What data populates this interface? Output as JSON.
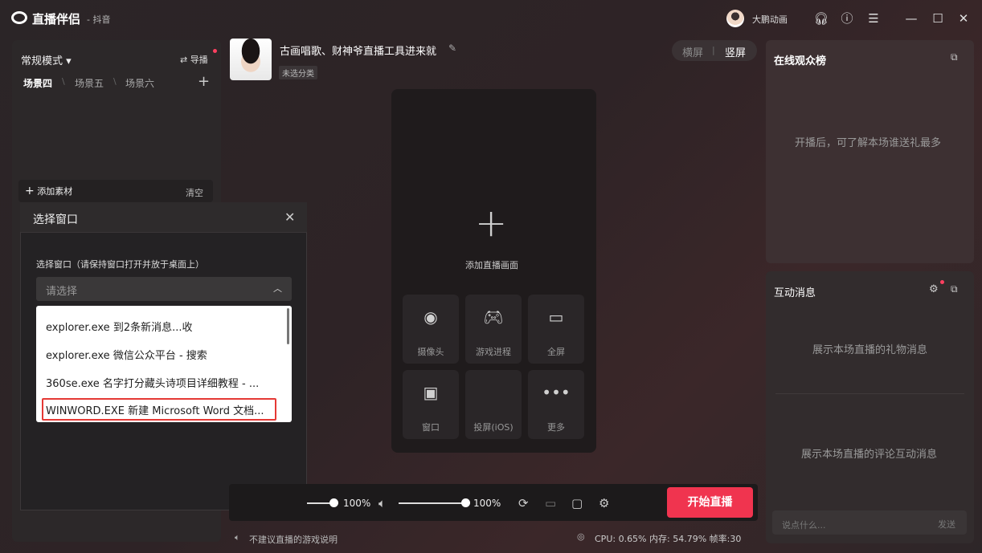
{
  "app": {
    "name": "直播伴侣",
    "sub": "- 抖音"
  },
  "user": {
    "name": "大鹏动画"
  },
  "titlebar_icons": [
    "headset-icon",
    "help-icon",
    "menu-icon",
    "minimize-icon",
    "maximize-icon",
    "close-icon"
  ],
  "left": {
    "mode": "常规模式 ▾",
    "import_label": "⇄ 导播",
    "scenes": [
      "场景四",
      "场景五",
      "场景六"
    ],
    "add_material": "添加素材",
    "clear": "清空"
  },
  "dialog": {
    "title": "选择窗口",
    "field_label": "选择窗口（请保持窗口打开并放于桌面上）",
    "placeholder": "请选择",
    "options": [
      "explorer.exe 到2条新消息...收",
      "explorer.exe 微信公众平台 - 搜索",
      "360se.exe 名字打分藏头诗项目详细教程 - ...",
      "WINWORD.EXE 新建 Microsoft Word 文档..."
    ]
  },
  "header": {
    "title": "古画唱歌、财神爷直播工具进来就",
    "category": "未选分类",
    "orient_h": "横屏",
    "orient_sep": "|",
    "orient_v": "竖屏"
  },
  "canvas": {
    "add_label": "添加直播画面",
    "tiles": [
      {
        "label": "摄像头",
        "icon": "camera-icon"
      },
      {
        "label": "游戏进程",
        "icon": "gamepad-icon"
      },
      {
        "label": "全屏",
        "icon": "monitor-icon"
      },
      {
        "label": "窗口",
        "icon": "window-icon"
      },
      {
        "label": "投屏(iOS)",
        "icon": "apple-icon"
      },
      {
        "label": "更多",
        "icon": "more-icon"
      }
    ]
  },
  "controls": {
    "mic_volume": "100%",
    "speaker_volume": "100%",
    "start": "开始直播",
    "warning": "不建议直播的游戏说明",
    "stats": "CPU: 0.65%    内存: 54.79%    帧率:30"
  },
  "right": {
    "rank_title": "在线观众榜",
    "rank_empty": "开播后，可了解本场谁送礼最多",
    "msg_title": "互动消息",
    "gift_empty": "展示本场直播的礼物消息",
    "comment_empty": "展示本场直播的评论互动消息",
    "chat_placeholder": "说点什么...",
    "send": "发送"
  }
}
